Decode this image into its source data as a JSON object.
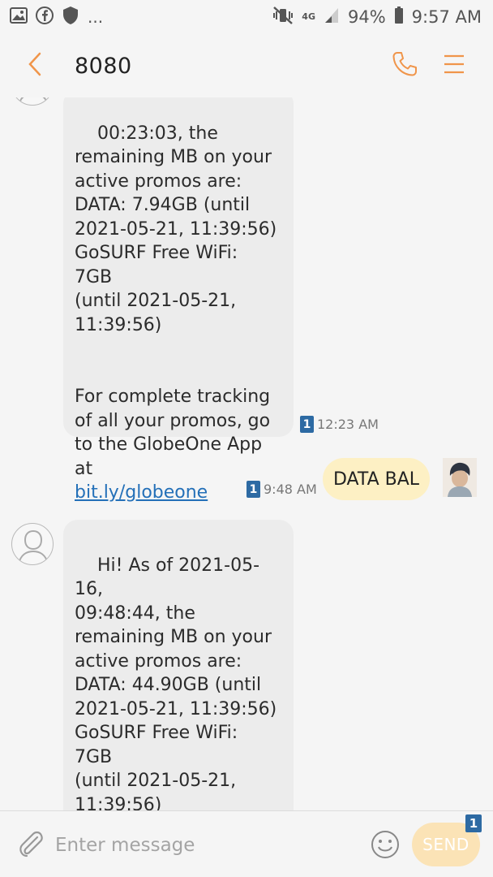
{
  "status_bar": {
    "notification_more": "...",
    "network_type": "4G",
    "battery_percent": "94%",
    "time": "9:57 AM"
  },
  "app_bar": {
    "title": "8080"
  },
  "messages": [
    {
      "direction": "incoming",
      "text": "00:23:03, the\nremaining MB on your\nactive promos are:\nDATA: 7.94GB (until\n2021-05-21, 11:39:56)\nGoSURF Free WiFi: 7GB\n(until 2021-05-21,\n11:39:56)\n\n\nFor complete tracking\nof all your promos, go\nto the GlobeOne App at\n",
      "link": "bit.ly/globeone",
      "sim": "1",
      "time": "12:23 AM"
    },
    {
      "direction": "outgoing",
      "text": "DATA BAL",
      "sim": "1",
      "time": "9:48 AM"
    },
    {
      "direction": "incoming",
      "text": "Hi! As of 2021-05-16,\n09:48:44, the\nremaining MB on your\nactive promos are:\nDATA: 44.90GB (until\n2021-05-21, 11:39:56)\nGoSURF Free WiFi: 7GB\n(until 2021-05-21,\n11:39:56)\n\n\nFor complete tracking",
      "sim": "",
      "time": ""
    }
  ],
  "composer": {
    "placeholder": "Enter message",
    "send_label": "SEND",
    "send_sim": "1"
  },
  "colors": {
    "accent": "#f0954a",
    "incoming_bubble": "#ececec",
    "outgoing_bubble": "#fdf0c4",
    "sim_badge": "#2d6aa3",
    "link": "#2470b8"
  },
  "icons": {
    "status_left": [
      "gallery-icon",
      "facebook-icon",
      "shield-icon"
    ],
    "status_right": [
      "mute-vibrate-icon",
      "signal-icon",
      "battery-icon"
    ],
    "app_bar": [
      "back-arrow-icon",
      "phone-icon",
      "menu-icon"
    ],
    "composer": [
      "paperclip-icon",
      "emoji-icon"
    ]
  }
}
